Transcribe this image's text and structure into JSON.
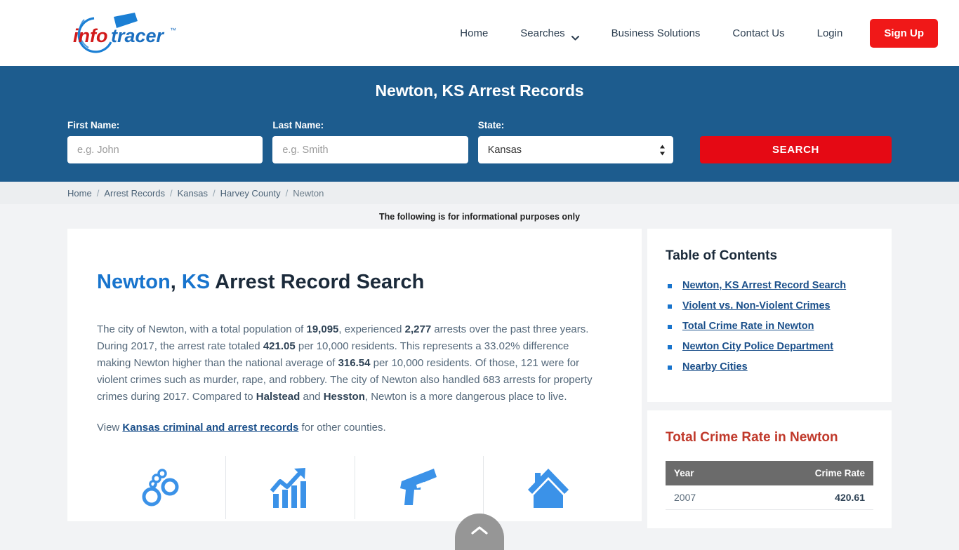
{
  "brand": {
    "name_info": "info",
    "name_tracer": "tracer",
    "tm": "™",
    "red": "#d21a1a",
    "blue": "#1b7fd4"
  },
  "header": {
    "nav": [
      {
        "label": "Home",
        "has_chevron": false
      },
      {
        "label": "Searches",
        "has_chevron": true
      },
      {
        "label": "Business Solutions",
        "has_chevron": false
      },
      {
        "label": "Contact Us",
        "has_chevron": false
      },
      {
        "label": "Login",
        "has_chevron": false
      }
    ],
    "signup_label": "Sign Up"
  },
  "hero": {
    "title": "Newton, KS Arrest Records",
    "first_name_label": "First Name:",
    "first_name_value": "",
    "first_name_placeholder": "e.g. John",
    "last_name_label": "Last Name:",
    "last_name_value": "",
    "last_name_placeholder": "e.g. Smith",
    "state_label": "State:",
    "state_value": "Kansas",
    "state_options": [
      "Kansas"
    ],
    "search_label": "SEARCH",
    "bg_color": "#1d5c8e",
    "search_button_color": "#e50914"
  },
  "breadcrumb": {
    "items": [
      "Home",
      "Arrest Records",
      "Kansas",
      "Harvey County",
      "Newton"
    ],
    "separator": "/"
  },
  "notice": "The following is for informational purposes only",
  "main": {
    "title_city": "Newton",
    "title_comma": ",",
    "title_state": "KS",
    "title_rest": "Arrest Record Search",
    "paragraph1": [
      {
        "t": "The city of Newton, with a total population of ",
        "b": false
      },
      {
        "t": "19,095",
        "b": true
      },
      {
        "t": ", experienced ",
        "b": false
      },
      {
        "t": "2,277",
        "b": true
      },
      {
        "t": " arrests over the past three years. During 2017, the arrest rate totaled ",
        "b": false
      },
      {
        "t": "421.05",
        "b": true
      },
      {
        "t": " per 10,000 residents. This represents a 33.02% difference making Newton higher than the national average of ",
        "b": false
      },
      {
        "t": "316.54",
        "b": true
      },
      {
        "t": " per 10,000 residents. Of those, 121 were for violent crimes such as murder, rape, and robbery. The city of Newton also handled 683 arrests for property crimes during 2017. Compared to ",
        "b": false
      },
      {
        "t": "Halstead",
        "b": true
      },
      {
        "t": " and ",
        "b": false
      },
      {
        "t": "Hesston",
        "b": true
      },
      {
        "t": ", Newton is a more dangerous place to live.",
        "b": false
      }
    ],
    "paragraph2_pre": "View ",
    "paragraph2_link": "Kansas criminal and arrest records",
    "paragraph2_post": " for other counties.",
    "icons": [
      "handcuffs-icon",
      "trending-up-chart-icon",
      "handgun-icon",
      "house-icon"
    ]
  },
  "sidebar": {
    "toc_title": "Table of Contents",
    "toc_items": [
      "Newton, KS Arrest Record Search",
      "Violent vs. Non-Violent Crimes",
      "Total Crime Rate in Newton",
      "Newton City Police Department",
      "Nearby Cities"
    ],
    "crime_title": "Total Crime Rate in Newton",
    "crime_headers": [
      "Year",
      "Crime Rate"
    ],
    "crime_rows": [
      {
        "year": "2007",
        "rate": "420.61"
      }
    ]
  },
  "scroll_top": {
    "icon": "chevron-up-icon"
  }
}
